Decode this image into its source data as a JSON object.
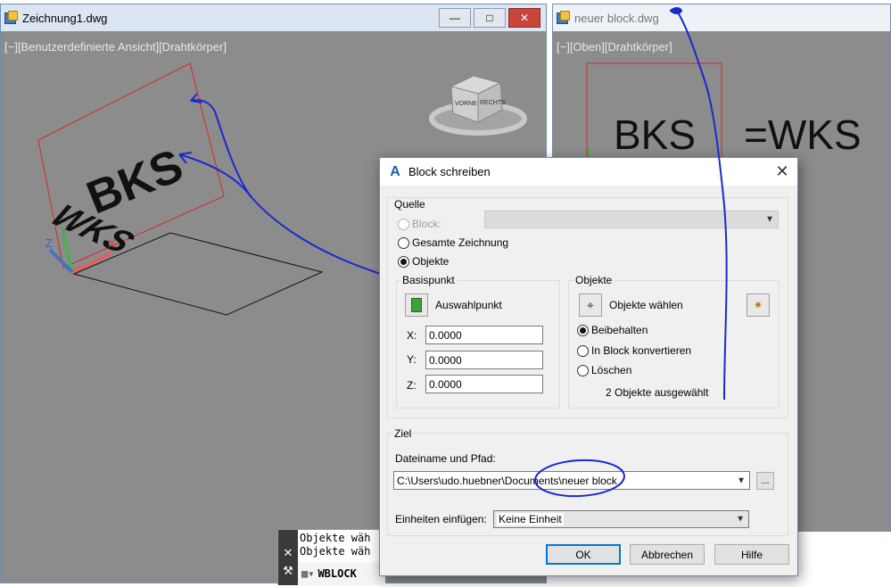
{
  "left_window": {
    "title": "Zeichnung1.dwg",
    "view_label": "[−][Benutzerdefinierte Ansicht][Drahtkörper]",
    "bks_text": "BKS",
    "wks_text": "WKS",
    "viewcube_front": "VORNE",
    "viewcube_right": "RECHTS",
    "axis_x": "X",
    "axis_y": "Y",
    "axis_z": "Z",
    "btn_minimize": "—",
    "btn_maximize": "□",
    "btn_close": "✕"
  },
  "right_window": {
    "title": "neuer block.dwg",
    "view_label": "[−][Oben][Drahtkörper]",
    "annotation_bks": "BKS",
    "annotation_wks": "=WKS"
  },
  "dialog": {
    "title": "Block schreiben",
    "close_glyph": "✕",
    "icon_glyph": "A",
    "quelle": {
      "label": "Quelle",
      "block_label": "Block:",
      "gesamte_label": "Gesamte Zeichnung",
      "objekte_label": "Objekte",
      "selected": "objekte"
    },
    "basispunkt": {
      "label": "Basispunkt",
      "pick_label": "Auswahlpunkt",
      "x_label": "X:",
      "y_label": "Y:",
      "z_label": "Z:",
      "x_value": "0.0000",
      "y_value": "0.0000",
      "z_value": "0.0000"
    },
    "objekte": {
      "label": "Objekte",
      "select_label": "Objekte wählen",
      "beibehalten": "Beibehalten",
      "konvertieren": "In Block konvertieren",
      "loeschen": "Löschen",
      "selected": "beibehalten",
      "count_text": "2 Objekte ausgewählt"
    },
    "ziel": {
      "label": "Ziel",
      "path_label": "Dateiname und Pfad:",
      "path_value": "C:\\Users\\udo.huebner\\Documents\\neuer block",
      "browse_label": "...",
      "units_label": "Einheiten einfügen:",
      "units_value": "Keine Einheit"
    },
    "buttons": {
      "ok": "OK",
      "cancel": "Abbrechen",
      "help": "Hilfe"
    }
  },
  "command_line": {
    "line1": "Objekte wäh",
    "line2": "Objekte wäh",
    "input": "WBLOCK",
    "close_glyph": "✕"
  },
  "colors": {
    "viewport_bg": "#8c8c8c",
    "ucs_frame": "#d42a2a",
    "annotation_ink": "#1a2ad0",
    "default_button_border": "#0078d7"
  }
}
